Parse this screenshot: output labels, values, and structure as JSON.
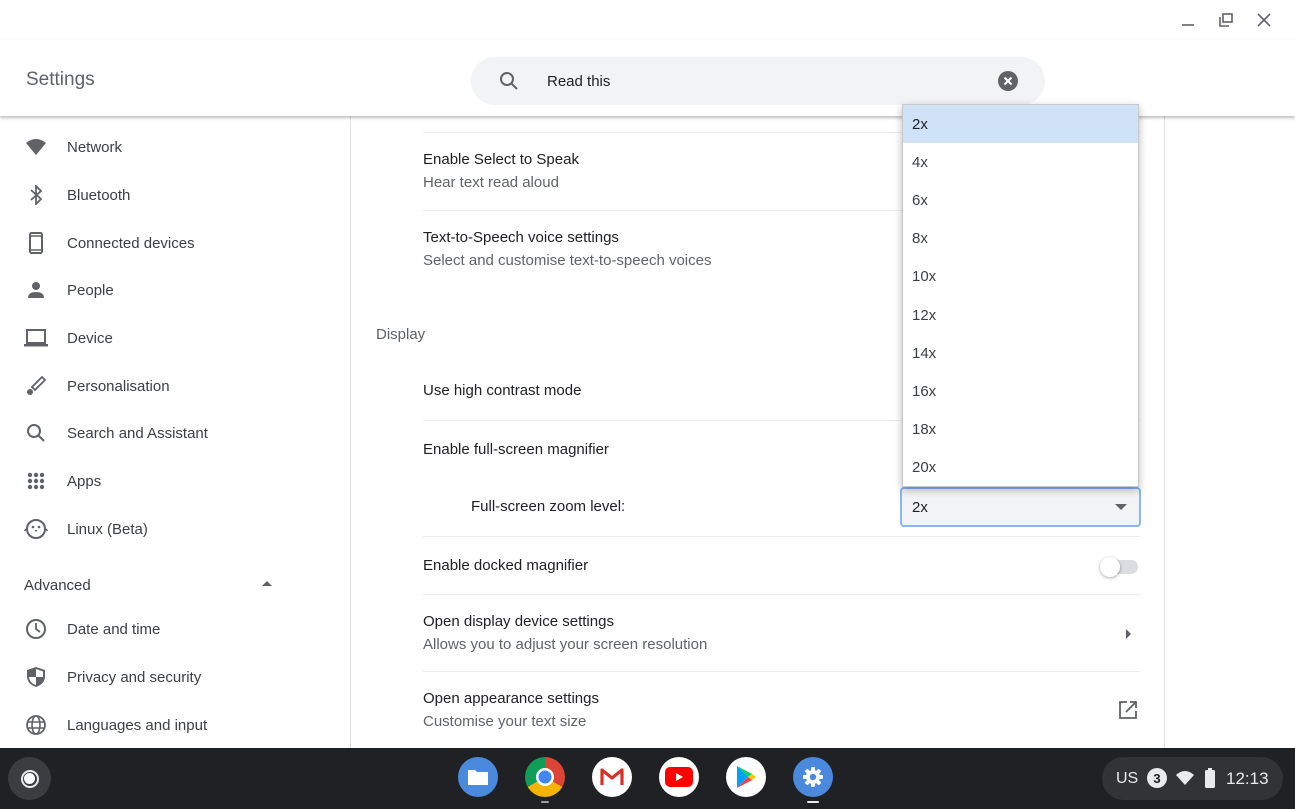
{
  "window": {
    "controls": [
      "minimize",
      "restore",
      "close"
    ]
  },
  "header": {
    "title": "Settings",
    "search": {
      "value": "Read this",
      "placeholder": "Search settings"
    }
  },
  "sidebar": {
    "items": [
      {
        "label": "Network",
        "icon": "wifi-icon"
      },
      {
        "label": "Bluetooth",
        "icon": "bluetooth-icon"
      },
      {
        "label": "Connected devices",
        "icon": "phone-icon"
      },
      {
        "label": "People",
        "icon": "person-icon"
      },
      {
        "label": "Device",
        "icon": "laptop-icon"
      },
      {
        "label": "Personalisation",
        "icon": "brush-icon"
      },
      {
        "label": "Search and Assistant",
        "icon": "search-icon"
      },
      {
        "label": "Apps",
        "icon": "apps-grid-icon"
      },
      {
        "label": "Linux (Beta)",
        "icon": "penguin-icon"
      }
    ],
    "advanced": {
      "label": "Advanced",
      "expanded": true,
      "items": [
        {
          "label": "Date and time",
          "icon": "clock-icon"
        },
        {
          "label": "Privacy and security",
          "icon": "shield-icon"
        },
        {
          "label": "Languages and input",
          "icon": "globe-icon"
        }
      ]
    }
  },
  "main": {
    "rows": [
      {
        "title": "Enable Select to Speak",
        "subtitle": "Hear text read aloud"
      },
      {
        "title": "Text-to-Speech voice settings",
        "subtitle": "Select and customise text-to-speech voices"
      }
    ],
    "display_section": {
      "title": "Display",
      "rows": [
        {
          "title": "Use high contrast mode"
        },
        {
          "title": "Enable full-screen magnifier"
        },
        {
          "title": "Full-screen zoom level:"
        },
        {
          "title": "Enable docked magnifier",
          "toggle": false
        },
        {
          "title": "Open display device settings",
          "subtitle": "Allows you to adjust your screen resolution"
        },
        {
          "title": "Open appearance settings",
          "subtitle": "Customise your text size"
        }
      ]
    },
    "zoom_select": {
      "value": "2x",
      "options": [
        "2x",
        "4x",
        "6x",
        "8x",
        "10x",
        "12x",
        "14x",
        "16x",
        "18x",
        "20x"
      ],
      "highlighted": "2x"
    }
  },
  "taskbar": {
    "apps": [
      {
        "name": "Files",
        "icon": "files-icon"
      },
      {
        "name": "Chrome",
        "icon": "chrome-icon",
        "running": true
      },
      {
        "name": "Gmail",
        "icon": "gmail-icon"
      },
      {
        "name": "YouTube",
        "icon": "youtube-icon"
      },
      {
        "name": "Play Store",
        "icon": "play-store-icon"
      },
      {
        "name": "Settings",
        "icon": "settings-icon",
        "running": true,
        "active": true
      }
    ],
    "tray": {
      "ime": "US",
      "notifications": "3",
      "time": "12:13"
    }
  },
  "colors": {
    "accent": "#1a73e8",
    "selected_option": "#cfe2f8",
    "select_border": "#8ab4f8",
    "shelf": "#202124"
  }
}
